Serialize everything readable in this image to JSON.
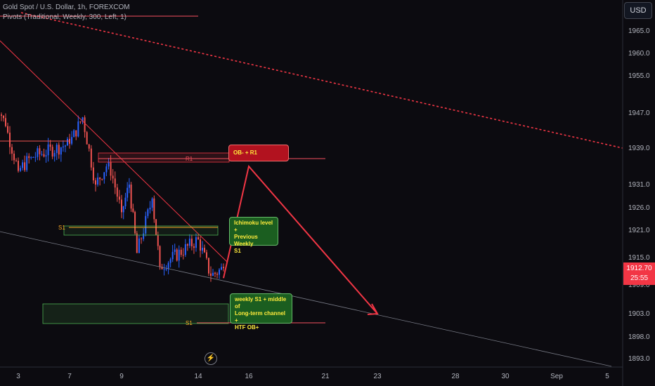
{
  "header": {
    "title": "Gold Spot / U.S. Dollar, 1h, FOREXCOM",
    "indicator": "Pivots (Traditional, Weekly, 300, Left, 1)"
  },
  "currency_button": "USD",
  "last_price": {
    "value": "1912.70",
    "countdown": "25:55",
    "color": "#f23645"
  },
  "colors": {
    "background": "#0c0b10",
    "up": "#2962ff",
    "down": "#ef5350",
    "trend": "#f23645",
    "pivot": "#f7525f"
  },
  "annotations": {
    "ob_r1": "OB- + R1",
    "ichimoku_lines": [
      "Ichimoku level +",
      "Previous Weekly",
      "S1"
    ],
    "weekly_lines": [
      "weekly S1 + middle of",
      "Long-term channel +",
      "HTF OB+"
    ]
  },
  "pivot_labels": {
    "r1": "R1",
    "s1_left": "S1",
    "s1_right": "S1"
  },
  "lightning_icon": "lightning-icon",
  "chart_data": {
    "type": "candlestick",
    "y_ticks": [
      1965.0,
      1960.0,
      1955.0,
      1947.0,
      1939.0,
      1931.0,
      1926.0,
      1921.0,
      1915.0,
      1909.0,
      1903.0,
      1898.0,
      1893.0
    ],
    "x_ticks": [
      "3",
      "7",
      "9",
      "14",
      "16",
      "21",
      "23",
      "28",
      "30",
      "Sep",
      "5"
    ],
    "levels": {
      "r1": 1936.3,
      "s1": 1921.6,
      "s1_next": 1905.6
    },
    "price_segments": [
      {
        "date": "Aug 1",
        "price": 1952.0
      },
      {
        "date": "Aug 2",
        "price": 1944.0
      },
      {
        "date": "Aug 3",
        "price": 1934.0
      },
      {
        "date": "Aug 4",
        "price": 1937.0
      },
      {
        "date": "Aug 7",
        "price": 1940.0
      },
      {
        "date": "Aug 7",
        "price": 1946.0
      },
      {
        "date": "Aug 8",
        "price": 1931.0
      },
      {
        "date": "Aug 8",
        "price": 1936.0
      },
      {
        "date": "Aug 9",
        "price": 1925.0
      },
      {
        "date": "Aug 9",
        "price": 1931.0
      },
      {
        "date": "Aug 10",
        "price": 1916.0
      },
      {
        "date": "Aug 11",
        "price": 1928.0
      },
      {
        "date": "Aug 11",
        "price": 1913.0
      },
      {
        "date": "Aug 14",
        "price": 1919.0
      },
      {
        "date": "Aug 14",
        "price": 1911.0
      },
      {
        "date": "Aug 15",
        "price": 1912.7
      }
    ],
    "projection": [
      {
        "date": "Aug 15",
        "price": 1910.5
      },
      {
        "date": "Aug 16",
        "price": 1935.0
      },
      {
        "date": "Aug 23",
        "price": 1903.0
      }
    ]
  }
}
